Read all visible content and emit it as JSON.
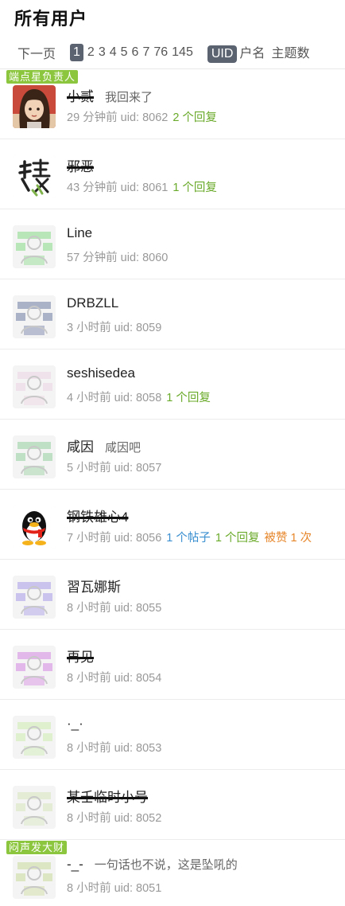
{
  "header": {
    "title": "所有用户"
  },
  "pager": {
    "next_label": "下一页",
    "pages": [
      "1",
      "2",
      "3",
      "4",
      "5",
      "6",
      "7",
      "76",
      "145"
    ],
    "current_page": "1",
    "sort_options": [
      "UID",
      "户名",
      "主题数"
    ],
    "active_sort": "UID"
  },
  "users": [
    {
      "badge": "端点星负责人",
      "name": "小贰",
      "banned": true,
      "signature": "我回来了",
      "time": "29 分钟前",
      "uid": "uid: 8062",
      "posts": "",
      "replies": "2 个回复",
      "likes": "",
      "avatar": "girl-avatar"
    },
    {
      "badge": "",
      "name": "邪恶",
      "banned": true,
      "signature": "",
      "time": "43 分钟前",
      "uid": "uid: 8061",
      "posts": "",
      "replies": "1 个回复",
      "likes": "",
      "avatar": "calligraphy-avatar"
    },
    {
      "badge": "",
      "name": "Line",
      "banned": false,
      "signature": "",
      "time": "57 分钟前",
      "uid": "uid: 8060",
      "posts": "",
      "replies": "",
      "likes": "",
      "avatar": "default-avatar",
      "tint": "#b8e6b8"
    },
    {
      "badge": "",
      "name": "DRBZLL",
      "banned": false,
      "signature": "",
      "time": "3 小时前",
      "uid": "uid: 8059",
      "posts": "",
      "replies": "",
      "likes": "",
      "avatar": "default-avatar",
      "tint": "#aab2c8"
    },
    {
      "badge": "",
      "name": "seshisedea",
      "banned": false,
      "signature": "",
      "time": "4 小时前",
      "uid": "uid: 8058",
      "posts": "",
      "replies": "1 个回复",
      "likes": "",
      "avatar": "default-avatar",
      "tint": "#efe2ea"
    },
    {
      "badge": "",
      "name": "咸因",
      "banned": false,
      "signature": "咸因吧",
      "time": "5 小时前",
      "uid": "uid: 8057",
      "posts": "",
      "replies": "",
      "likes": "",
      "avatar": "default-avatar",
      "tint": "#bfe0c4"
    },
    {
      "badge": "",
      "name": "钢铁雄心4",
      "banned": true,
      "signature": "",
      "time": "7 小时前",
      "uid": "uid: 8056",
      "posts": "1 个帖子",
      "replies": "1 个回复",
      "likes": "被赞 1 次",
      "avatar": "penguin-avatar"
    },
    {
      "badge": "",
      "name": "習瓦娜斯",
      "banned": false,
      "signature": "",
      "time": "8 小时前",
      "uid": "uid: 8055",
      "posts": "",
      "replies": "",
      "likes": "",
      "avatar": "default-avatar",
      "tint": "#c9c3ee"
    },
    {
      "badge": "",
      "name": "再见",
      "banned": true,
      "signature": "",
      "time": "8 小时前",
      "uid": "uid: 8054",
      "posts": "",
      "replies": "",
      "likes": "",
      "avatar": "default-avatar",
      "tint": "#e2b8ea"
    },
    {
      "badge": "",
      "name": "·_·",
      "banned": false,
      "signature": "",
      "time": "8 小时前",
      "uid": "uid: 8053",
      "posts": "",
      "replies": "",
      "likes": "",
      "avatar": "default-avatar",
      "tint": "#dff0cf"
    },
    {
      "badge": "",
      "name": "某壬临时小号",
      "banned": true,
      "signature": "",
      "time": "8 小时前",
      "uid": "uid: 8052",
      "posts": "",
      "replies": "",
      "likes": "",
      "avatar": "default-avatar",
      "tint": "#e4ecd6"
    },
    {
      "badge": "闷声发大财",
      "name": "-_-",
      "banned": false,
      "signature": "一句话也不说，这是坠吼的",
      "time": "8 小时前",
      "uid": "uid: 8051",
      "posts": "",
      "replies": "",
      "likes": "",
      "avatar": "default-avatar",
      "tint": "#dde6c2"
    }
  ]
}
